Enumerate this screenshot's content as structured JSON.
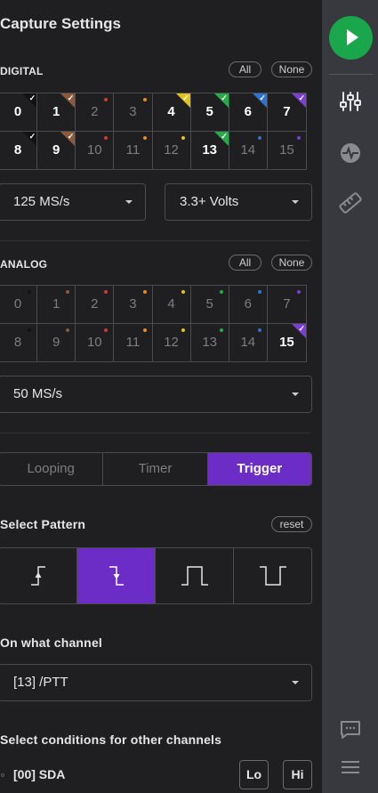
{
  "title": "Capture Settings",
  "digital": {
    "heading": "DIGITAL",
    "all_label": "All",
    "none_label": "None",
    "channels": [
      {
        "label": "0",
        "on": true,
        "color": "#111111"
      },
      {
        "label": "1",
        "on": true,
        "color": "#8a5a3a"
      },
      {
        "label": "2",
        "on": false,
        "color": "#d23a2c"
      },
      {
        "label": "3",
        "on": false,
        "color": "#e58c1a"
      },
      {
        "label": "4",
        "on": true,
        "color": "#e3c21f"
      },
      {
        "label": "5",
        "on": true,
        "color": "#2aa84a"
      },
      {
        "label": "6",
        "on": true,
        "color": "#2f74d0"
      },
      {
        "label": "7",
        "on": true,
        "color": "#7a3ed3"
      },
      {
        "label": "8",
        "on": true,
        "color": "#111111"
      },
      {
        "label": "9",
        "on": true,
        "color": "#8a5a3a"
      },
      {
        "label": "10",
        "on": false,
        "color": "#d23a2c"
      },
      {
        "label": "11",
        "on": false,
        "color": "#e58c1a"
      },
      {
        "label": "12",
        "on": false,
        "color": "#e3c21f"
      },
      {
        "label": "13",
        "on": true,
        "color": "#2aa84a"
      },
      {
        "label": "14",
        "on": false,
        "color": "#2f74d0"
      },
      {
        "label": "15",
        "on": false,
        "color": "#7a3ed3"
      }
    ],
    "sample_rate": "125 MS/s",
    "voltage": "3.3+ Volts"
  },
  "analog": {
    "heading": "ANALOG",
    "all_label": "All",
    "none_label": "None",
    "channels": [
      {
        "label": "0",
        "on": false,
        "color": "#111111"
      },
      {
        "label": "1",
        "on": false,
        "color": "#8a5a3a"
      },
      {
        "label": "2",
        "on": false,
        "color": "#d23a2c"
      },
      {
        "label": "3",
        "on": false,
        "color": "#e58c1a"
      },
      {
        "label": "4",
        "on": false,
        "color": "#e3c21f"
      },
      {
        "label": "5",
        "on": false,
        "color": "#2aa84a"
      },
      {
        "label": "6",
        "on": false,
        "color": "#2f74d0"
      },
      {
        "label": "7",
        "on": false,
        "color": "#7a3ed3"
      },
      {
        "label": "8",
        "on": false,
        "color": "#111111"
      },
      {
        "label": "9",
        "on": false,
        "color": "#8a5a3a"
      },
      {
        "label": "10",
        "on": false,
        "color": "#d23a2c"
      },
      {
        "label": "11",
        "on": false,
        "color": "#e58c1a"
      },
      {
        "label": "12",
        "on": false,
        "color": "#e3c21f"
      },
      {
        "label": "13",
        "on": false,
        "color": "#2aa84a"
      },
      {
        "label": "14",
        "on": false,
        "color": "#2f74d0"
      },
      {
        "label": "15",
        "on": true,
        "color": "#7a3ed3"
      }
    ],
    "sample_rate": "50 MS/s"
  },
  "mode": {
    "options": [
      "Looping",
      "Timer",
      "Trigger"
    ],
    "selected": "Trigger"
  },
  "pattern": {
    "heading": "Select Pattern",
    "reset_label": "reset",
    "options": [
      "rising-edge-icon",
      "falling-edge-icon",
      "positive-pulse-icon",
      "negative-pulse-icon"
    ],
    "selected": "falling-edge-icon"
  },
  "channel_select": {
    "heading": "On what channel",
    "value": "[13] /PTT"
  },
  "conditions": {
    "heading": "Select conditions for other channels",
    "rows": [
      {
        "label": "[00] SDA",
        "lo": "Lo",
        "hi": "Hi"
      }
    ]
  },
  "colors": {
    "accent": "#6c2dc7",
    "play": "#1aa64b"
  }
}
